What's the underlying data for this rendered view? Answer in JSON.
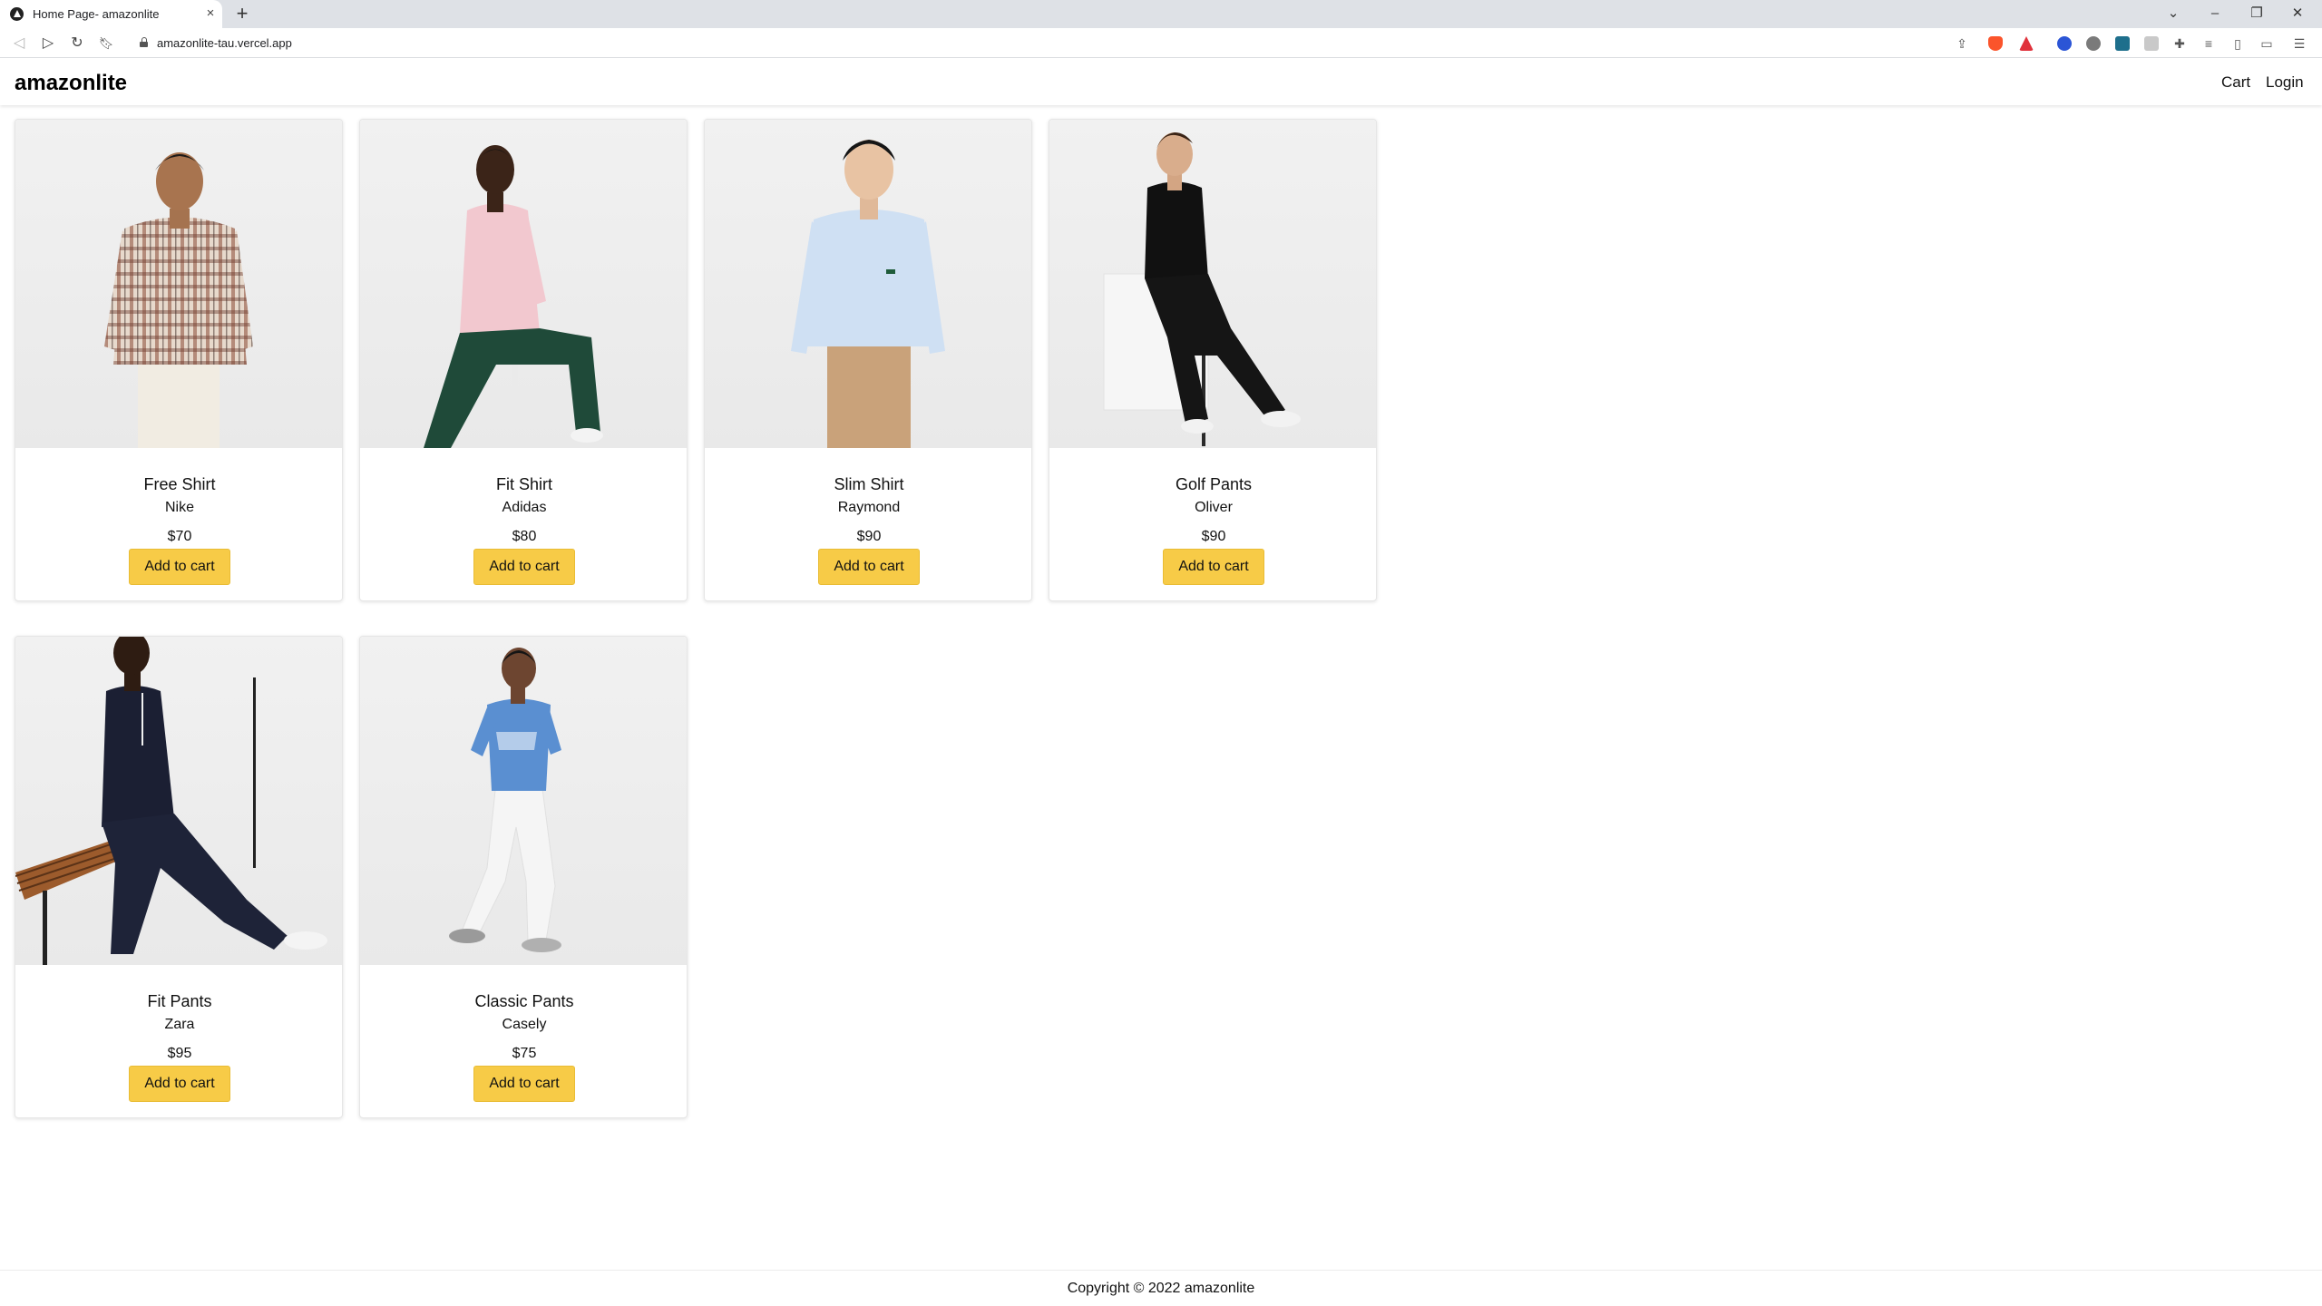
{
  "browser": {
    "tab_title": "Home Page- amazonlite",
    "tab_close": "×",
    "new_tab": "+",
    "url": "amazonlite-tau.vercel.app"
  },
  "site": {
    "brand": "amazonlite",
    "nav": {
      "cart": "Cart",
      "login": "Login"
    }
  },
  "products": [
    {
      "name": "Free Shirt",
      "brand": "Nike",
      "price": "$70",
      "button": "Add to cart",
      "image": "man-in-plaid-shirt-photo"
    },
    {
      "name": "Fit Shirt",
      "brand": "Adidas",
      "price": "$80",
      "button": "Add to cart",
      "image": "man-in-pink-shirt-seated-photo"
    },
    {
      "name": "Slim Shirt",
      "brand": "Raymond",
      "price": "$90",
      "button": "Add to cart",
      "image": "man-in-light-blue-shirt-photo"
    },
    {
      "name": "Golf Pants",
      "brand": "Oliver",
      "price": "$90",
      "button": "Add to cart",
      "image": "man-in-black-polo-with-golf-club-photo"
    },
    {
      "name": "Fit Pants",
      "brand": "Zara",
      "price": "$95",
      "button": "Add to cart",
      "image": "man-in-navy-seated-on-bench-photo"
    },
    {
      "name": "Classic Pants",
      "brand": "Casely",
      "price": "$75",
      "button": "Add to cart",
      "image": "man-in-blue-tee-white-pants-photo"
    }
  ],
  "footer": {
    "text": "Copyright © 2022 amazonlite"
  },
  "colors": {
    "button": "#f7cb47",
    "header_bg": "#ffffff",
    "tabbar_bg": "#dee1e6"
  }
}
